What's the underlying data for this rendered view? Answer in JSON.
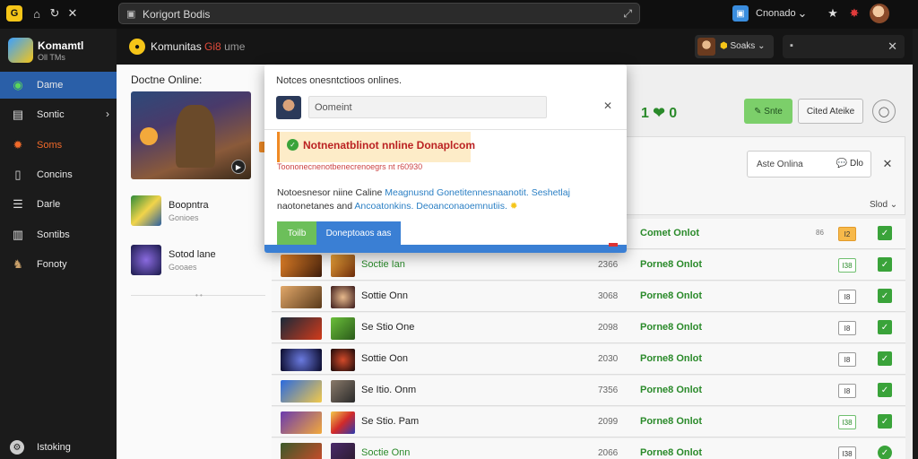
{
  "browser": {
    "url_text": "Korigort Bodis",
    "ext_label": "Cnonado",
    "logo_glyph": "G"
  },
  "sidebar": {
    "brand_title": "Komamtl",
    "brand_sub": "Oll TMs",
    "items": [
      {
        "label": "Dame",
        "icon": "gamepad-icon",
        "active": true
      },
      {
        "label": "Sontic",
        "icon": "monitor-icon",
        "has_chevron": true
      },
      {
        "label": "Soms",
        "icon": "splash-icon"
      },
      {
        "label": "Concins",
        "icon": "file-icon"
      },
      {
        "label": "Darle",
        "icon": "list-icon"
      },
      {
        "label": "Sontibs",
        "icon": "document-icon"
      },
      {
        "label": "Fonoty",
        "icon": "character-icon"
      }
    ],
    "bottom_item": {
      "label": "Istoking"
    }
  },
  "header": {
    "title": "Komunitas",
    "brand": "Gi8",
    "suffix": "ume",
    "user_label": "Soaks"
  },
  "left_panel": {
    "title": "Doctne Online:",
    "items": [
      {
        "title": "Boopntra",
        "sub": "Gonioes"
      },
      {
        "title": "Sotod lane",
        "sub": "Gooaes"
      }
    ]
  },
  "toolbar": {
    "score": "1 ❤ 0",
    "green_btn": "Snte",
    "outline_btn": "Cited Ateike",
    "filter_label": "Aste Onlina",
    "filter_value": "Dlo",
    "sort_label": "Slod"
  },
  "table": {
    "rows": [
      {
        "name": "",
        "year": "",
        "status": "Comet Onlot",
        "tag": "I2",
        "tag_style": "orange",
        "mini": "86"
      },
      {
        "name": "Soctie Ian",
        "year": "2366",
        "status": "Porne8 Onlot",
        "tag": "I38",
        "tag_style": "gn",
        "name_green": true
      },
      {
        "name": "Sottie Onn",
        "year": "3068",
        "status": "Porne8 Onlot",
        "tag": "I8",
        "tag_style": ""
      },
      {
        "name": "Se Stio One",
        "year": "2098",
        "status": "Porne8 Onlot",
        "tag": "I8",
        "tag_style": ""
      },
      {
        "name": "Sottie Oon",
        "year": "2030",
        "status": "Porne8 Onlot",
        "tag": "I8",
        "tag_style": ""
      },
      {
        "name": "Se Itio. Onm",
        "year": "7356",
        "status": "Porne8 Onlot",
        "tag": "I8",
        "tag_style": ""
      },
      {
        "name": "Se Stio. Pam",
        "year": "2099",
        "status": "Porne8 Onlot",
        "tag": "I38",
        "tag_style": "gn"
      },
      {
        "name": "Soctie Onn",
        "year": "2066",
        "status": "Porne8 Onlot",
        "tag": "I38",
        "tag_style": ""
      }
    ]
  },
  "modal": {
    "title": "Notces onesntctioos onlines.",
    "input_value": "Oomeint",
    "alert_title": "Notnenatblinot nnline Donaplcom",
    "alert_sub": "Toononecnenotbenecrenoegrs nt r60930",
    "body_a": "Notoesnesor niine Caline ",
    "body_hl1": "Meagnusnd Gonetitennesnaanotit. Seshetlaj",
    "body_b": "naotonetanes and ",
    "body_hl2": "Ancoatonkins. Deoanconaoemnutiis.",
    "btn_a": "Toilb",
    "btn_b": "Doneptoaos aas"
  },
  "colors": {
    "accent_blue": "#3a7fd4",
    "accent_green": "#6cbf5a",
    "alert_orange": "#f08a24",
    "sidebar_active": "#2a5fa8"
  }
}
